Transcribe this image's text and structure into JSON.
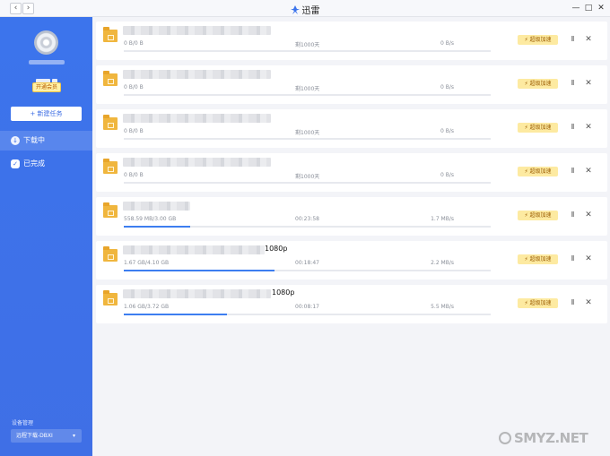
{
  "window": {
    "title": "迅雷",
    "back_glyph": "‹",
    "forward_glyph": "›",
    "min_glyph": "—",
    "max_glyph": "□",
    "close_glyph": "✕"
  },
  "sidebar": {
    "vip_label": "开通会员",
    "new_task_label": "+ 新建任务",
    "nav": [
      {
        "label": "下载中",
        "icon": "download-icon",
        "icon_glyph": "↓",
        "active": true
      },
      {
        "label": "已完成",
        "icon": "check-shield-icon",
        "icon_glyph": "✓",
        "active": false
      }
    ],
    "device_label": "设备管理",
    "device_value": "远程下载-DBXI",
    "device_caret": "▾"
  },
  "tasks": [
    {
      "name_suffix": "",
      "size": "0 B/0 B",
      "time": "剩1000天",
      "speed": "0 B/s",
      "progress": 0.0
    },
    {
      "name_suffix": "",
      "size": "0 B/0 B",
      "time": "剩1000天",
      "speed": "0 B/s",
      "progress": 0.0
    },
    {
      "name_suffix": "",
      "size": "0 B/0 B",
      "time": "剩1000天",
      "speed": "0 B/s",
      "progress": 0.0
    },
    {
      "name_suffix": "",
      "size": "0 B/0 B",
      "time": "剩1000天",
      "speed": "0 B/s",
      "progress": 0.0
    },
    {
      "name_suffix": "",
      "size": "558.59 MB/3.00 GB",
      "time": "00:23:58",
      "speed": "1.7 MB/s",
      "progress": 0.18
    },
    {
      "name_suffix": "1080p",
      "size": "1.67 GB/4.10 GB",
      "time": "00:18:47",
      "speed": "2.2 MB/s",
      "progress": 0.41
    },
    {
      "name_suffix": "1080p",
      "size": "1.06 GB/3.72 GB",
      "time": "00:08:17",
      "speed": "5.5 MB/s",
      "progress": 0.28
    }
  ],
  "task_actions": {
    "boost_label": "⚡ 超级加速",
    "pause_glyph": "II",
    "close_glyph": "✕"
  },
  "watermark": "SMYZ.NET",
  "colors": {
    "accent": "#3c74ec",
    "progress": "#3d7ef0",
    "boost_bg": "#fdeaa1"
  }
}
